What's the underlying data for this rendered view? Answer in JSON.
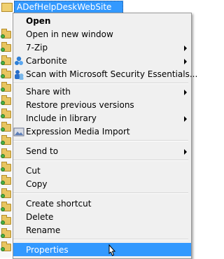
{
  "folder": {
    "name": "ADefHelpDeskWebSite"
  },
  "menu": {
    "items": [
      {
        "label": "Open",
        "bold": true,
        "arrow": false,
        "icon": ""
      },
      {
        "label": "Open in new window",
        "arrow": false,
        "icon": ""
      },
      {
        "label": "7-Zip",
        "arrow": true,
        "icon": ""
      },
      {
        "label": "Carbonite",
        "arrow": true,
        "icon": "carbonite-icon"
      },
      {
        "label": "Scan with Microsoft Security Essentials...",
        "arrow": false,
        "icon": "security-essentials-icon"
      },
      {
        "label": "Share with",
        "arrow": true,
        "icon": ""
      },
      {
        "label": "Restore previous versions",
        "arrow": false,
        "icon": ""
      },
      {
        "label": "Include in library",
        "arrow": true,
        "icon": ""
      },
      {
        "label": "Expression Media Import",
        "arrow": false,
        "icon": "expression-media-icon"
      },
      {
        "label": "Send to",
        "arrow": true,
        "icon": ""
      },
      {
        "label": "Cut",
        "arrow": false,
        "icon": ""
      },
      {
        "label": "Copy",
        "arrow": false,
        "icon": ""
      },
      {
        "label": "Create shortcut",
        "arrow": false,
        "icon": ""
      },
      {
        "label": "Delete",
        "arrow": false,
        "icon": ""
      },
      {
        "label": "Rename",
        "arrow": false,
        "icon": ""
      },
      {
        "label": "Properties",
        "arrow": false,
        "icon": "",
        "highlighted": true
      }
    ]
  },
  "colors": {
    "selection": "#3399ff",
    "menu_bg": "#f0f0f0"
  }
}
